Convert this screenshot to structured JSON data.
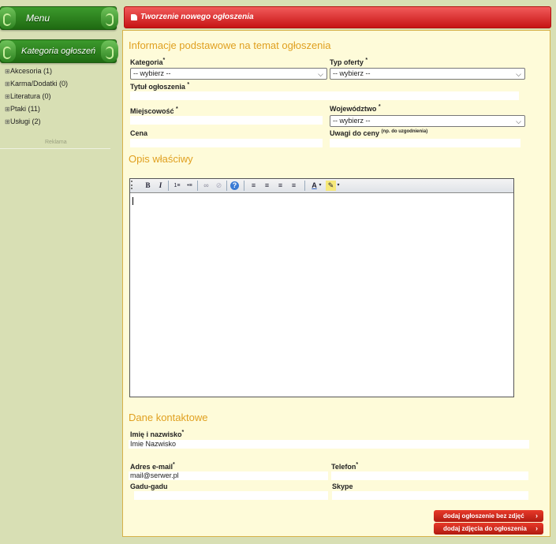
{
  "sidebar": {
    "menu_label": "Menu",
    "category_header": "Kategoria ogłoszeń",
    "categories": [
      {
        "label": "Akcesoria (1)"
      },
      {
        "label": "Karma/Dodatki (0)"
      },
      {
        "label": "Literatura (0)"
      },
      {
        "label": "Ptaki (11)"
      },
      {
        "label": "Usługi (2)"
      }
    ],
    "ad_label": "Reklama"
  },
  "header": {
    "title": "Tworzenie nowego ogłoszenia"
  },
  "basic": {
    "section_title": "Informacje podstawowe na temat ogłoszenia",
    "category_label": "Kategoria",
    "category_value": "-- wybierz --",
    "offer_type_label": "Typ oferty",
    "offer_type_value": "-- wybierz --",
    "title_label": "Tytuł ogłoszenia",
    "city_label": "Miejscowość",
    "province_label": "Województwo",
    "province_value": "-- wybierz --",
    "price_label": "Cena",
    "price_notes_label": "Uwagi do ceny",
    "price_notes_hint": "(np. do uzgodnienia)",
    "required_mark": "*"
  },
  "description": {
    "section_title": "Opis właściwy",
    "toolbar": {
      "bold": "B",
      "italic": "I",
      "numbered_list": "1≡",
      "bulleted_list": "•≡",
      "link": "∞",
      "unlink": "⊘",
      "help": "?",
      "align_left": "≡",
      "align_center": "≡",
      "align_right": "≡",
      "justify": "≡",
      "font_color": "A",
      "highlight": "✎"
    }
  },
  "contact": {
    "section_title": "Dane kontaktowe",
    "name_label": "Imię i nazwisko",
    "name_value": "Imie Nazwisko",
    "email_label": "Adres e-mail",
    "email_value": "mail@serwer.pl",
    "phone_label": "Telefon",
    "gg_label": "Gadu-gadu",
    "skype_label": "Skype"
  },
  "buttons": {
    "add_without_photos": "dodaj ogłoszenie bez zdjęć",
    "add_photos": "dodaj zdjęcia do ogłoszenia",
    "arrow": "›"
  }
}
